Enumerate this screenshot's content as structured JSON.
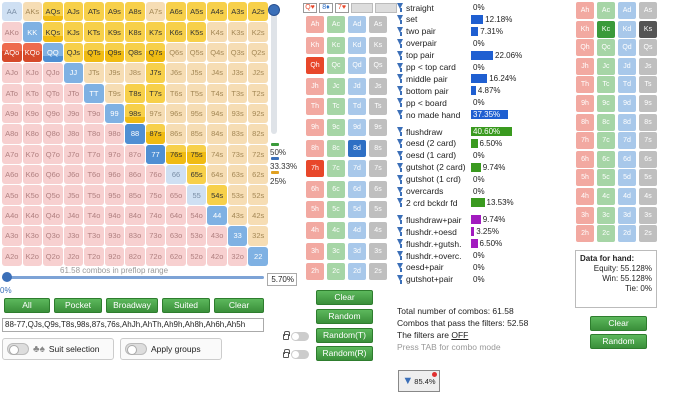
{
  "grid": {
    "ranks": [
      "A",
      "K",
      "Q",
      "J",
      "T",
      "9",
      "8",
      "7",
      "6",
      "5",
      "4",
      "3",
      "2"
    ],
    "cells": [
      [
        [
          "AA",
          "st"
        ],
        [
          "AKs",
          "st"
        ],
        [
          "AQs",
          "sel",
          0.3
        ],
        [
          "AJs",
          "sel"
        ],
        [
          "ATs",
          "sel"
        ],
        [
          "A9s",
          "sel"
        ],
        [
          "A8s",
          "sel"
        ],
        [
          "A7s",
          "st"
        ],
        [
          "A6s",
          "sel"
        ],
        [
          "A5s",
          "sel"
        ],
        [
          "A4s",
          "sel"
        ],
        [
          "A3s",
          "sel"
        ],
        [
          "A2s",
          "sel"
        ]
      ],
      [
        [
          "AKo",
          "st"
        ],
        [
          "KK",
          "sel"
        ],
        [
          "KQs",
          "sel",
          0.3
        ],
        [
          "KJs",
          "sel"
        ],
        [
          "KTs",
          "sel"
        ],
        [
          "K9s",
          "sel"
        ],
        [
          "K8s",
          "sel"
        ],
        [
          "K7s",
          "sel"
        ],
        [
          "K6s",
          "sel"
        ],
        [
          "K5s",
          "sel"
        ],
        [
          "K4s",
          "st"
        ],
        [
          "K3s",
          "st"
        ],
        [
          "K2s",
          "st"
        ]
      ],
      [
        [
          "AQo",
          "sel",
          0.6
        ],
        [
          "KQo",
          "sel",
          0.6
        ],
        [
          "QQ",
          "sel",
          0.3
        ],
        [
          "QJs",
          "sel"
        ],
        [
          "QTs",
          "sel",
          0.6
        ],
        [
          "Q9s",
          "sel",
          0.6
        ],
        [
          "Q8s",
          "sel"
        ],
        [
          "Q7s",
          "sel",
          0.6
        ],
        [
          "Q6s",
          "st"
        ],
        [
          "Q5s",
          "st"
        ],
        [
          "Q4s",
          "st"
        ],
        [
          "Q3s",
          "st"
        ],
        [
          "Q2s",
          "st"
        ]
      ],
      [
        [
          "AJo",
          "st"
        ],
        [
          "KJo",
          "st"
        ],
        [
          "QJo",
          "st"
        ],
        [
          "JJ",
          "sel"
        ],
        [
          "JTs",
          "st"
        ],
        [
          "J9s",
          "st"
        ],
        [
          "J8s",
          "st"
        ],
        [
          "J7s",
          "sel"
        ],
        [
          "J6s",
          "st"
        ],
        [
          "J5s",
          "st"
        ],
        [
          "J4s",
          "st"
        ],
        [
          "J3s",
          "st"
        ],
        [
          "J2s",
          "st"
        ]
      ],
      [
        [
          "ATo",
          "st"
        ],
        [
          "KTo",
          "st"
        ],
        [
          "QTo",
          "st"
        ],
        [
          "JTo",
          "st"
        ],
        [
          "TT",
          "sel"
        ],
        [
          "T9s",
          "st"
        ],
        [
          "T8s",
          "sel"
        ],
        [
          "T7s",
          "sel"
        ],
        [
          "T6s",
          "st"
        ],
        [
          "T5s",
          "st"
        ],
        [
          "T4s",
          "st"
        ],
        [
          "T3s",
          "st"
        ],
        [
          "T2s",
          "st"
        ]
      ],
      [
        [
          "A9o",
          "st"
        ],
        [
          "K9o",
          "st"
        ],
        [
          "Q9o",
          "st"
        ],
        [
          "J9o",
          "st"
        ],
        [
          "T9o",
          "st"
        ],
        [
          "99",
          "sel"
        ],
        [
          "98s",
          "sel",
          0.3
        ],
        [
          "97s",
          "st"
        ],
        [
          "96s",
          "st"
        ],
        [
          "95s",
          "st"
        ],
        [
          "94s",
          "st"
        ],
        [
          "93s",
          "st"
        ],
        [
          "92s",
          "st"
        ]
      ],
      [
        [
          "A8o",
          "st"
        ],
        [
          "K8o",
          "st"
        ],
        [
          "Q8o",
          "st"
        ],
        [
          "J8o",
          "st"
        ],
        [
          "T8o",
          "st"
        ],
        [
          "98o",
          "st"
        ],
        [
          "88",
          "sel",
          1
        ],
        [
          "87s",
          "sel",
          0.6
        ],
        [
          "86s",
          "st"
        ],
        [
          "85s",
          "st"
        ],
        [
          "84s",
          "st"
        ],
        [
          "83s",
          "st"
        ],
        [
          "82s",
          "st"
        ]
      ],
      [
        [
          "A7o",
          "st"
        ],
        [
          "K7o",
          "st"
        ],
        [
          "Q7o",
          "st"
        ],
        [
          "J7o",
          "st"
        ],
        [
          "T7o",
          "st"
        ],
        [
          "97o",
          "st"
        ],
        [
          "87o",
          "st"
        ],
        [
          "77",
          "sel",
          1
        ],
        [
          "76s",
          "sel",
          0.6
        ],
        [
          "75s",
          "sel",
          0.6
        ],
        [
          "74s",
          "st"
        ],
        [
          "73s",
          "st"
        ],
        [
          "72s",
          "st"
        ]
      ],
      [
        [
          "A6o",
          "st"
        ],
        [
          "K6o",
          "st"
        ],
        [
          "Q6o",
          "st"
        ],
        [
          "J6o",
          "st"
        ],
        [
          "T6o",
          "st"
        ],
        [
          "96o",
          "st"
        ],
        [
          "86o",
          "st"
        ],
        [
          "76o",
          "st"
        ],
        [
          "66",
          "st"
        ],
        [
          "65s",
          "sel"
        ],
        [
          "64s",
          "st"
        ],
        [
          "63s",
          "st"
        ],
        [
          "62s",
          "st"
        ]
      ],
      [
        [
          "A5o",
          "st"
        ],
        [
          "K5o",
          "st"
        ],
        [
          "Q5o",
          "st"
        ],
        [
          "J5o",
          "st"
        ],
        [
          "T5o",
          "st"
        ],
        [
          "95o",
          "st"
        ],
        [
          "85o",
          "st"
        ],
        [
          "75o",
          "st"
        ],
        [
          "65o",
          "st"
        ],
        [
          "55",
          "st"
        ],
        [
          "54s",
          "sel"
        ],
        [
          "53s",
          "st"
        ],
        [
          "52s",
          "st"
        ]
      ],
      [
        [
          "A4o",
          "st"
        ],
        [
          "K4o",
          "st"
        ],
        [
          "Q4o",
          "st"
        ],
        [
          "J4o",
          "st"
        ],
        [
          "T4o",
          "st"
        ],
        [
          "94o",
          "st"
        ],
        [
          "84o",
          "st"
        ],
        [
          "74o",
          "st"
        ],
        [
          "64o",
          "st"
        ],
        [
          "54o",
          "st"
        ],
        [
          "44",
          "sel"
        ],
        [
          "43s",
          "st"
        ],
        [
          "42s",
          "st"
        ]
      ],
      [
        [
          "A3o",
          "st"
        ],
        [
          "K3o",
          "st"
        ],
        [
          "Q3o",
          "st"
        ],
        [
          "J3o",
          "st"
        ],
        [
          "T3o",
          "st"
        ],
        [
          "93o",
          "st"
        ],
        [
          "83o",
          "st"
        ],
        [
          "73o",
          "st"
        ],
        [
          "63o",
          "st"
        ],
        [
          "53o",
          "st"
        ],
        [
          "43o",
          "st"
        ],
        [
          "33",
          "sel"
        ],
        [
          "32s",
          "st"
        ]
      ],
      [
        [
          "A2o",
          "st"
        ],
        [
          "K2o",
          "st"
        ],
        [
          "Q2o",
          "st"
        ],
        [
          "J2o",
          "st"
        ],
        [
          "T2o",
          "st"
        ],
        [
          "92o",
          "st"
        ],
        [
          "82o",
          "st"
        ],
        [
          "72o",
          "st"
        ],
        [
          "62o",
          "st"
        ],
        [
          "52o",
          "st"
        ],
        [
          "42o",
          "st"
        ],
        [
          "32o",
          "st"
        ],
        [
          "22",
          "sel"
        ]
      ]
    ]
  },
  "slider": {
    "vertical_labels": [
      "50%",
      "33.33%",
      "25%"
    ],
    "combos_caption": "61.58 combos in preflop range",
    "percent_value": "5.70%",
    "slider_pct": "0%"
  },
  "buttons": {
    "all": "All",
    "pocket": "Pocket",
    "broadway": "Broadway",
    "suited": "Suited",
    "clear": "Clear"
  },
  "range_text": "88-77,QJs,Q9s,T8s,98s,87s,76s,AhJh,AhTh,Ah9h,Ah8h,Ah6h,Ah5h",
  "toggles": {
    "suit_selection": "Suit selection",
    "apply_groups": "Apply groups"
  },
  "board": {
    "slots": [
      "Q♥",
      "8♦",
      "7♥"
    ],
    "ranks": [
      "A",
      "K",
      "Q",
      "J",
      "T",
      "9",
      "8",
      "7",
      "6",
      "5",
      "4",
      "3",
      "2"
    ],
    "suits": [
      "h",
      "c",
      "d",
      "s"
    ],
    "selected": [
      "Qh",
      "8d",
      "7h"
    ],
    "clear": "Clear",
    "random": "Random",
    "random_t": "Random(T)",
    "random_r": "Random(R)"
  },
  "stats": [
    {
      "label": "straight",
      "value": "0%",
      "pct": 0,
      "color": "#1f5fd1"
    },
    {
      "label": "set",
      "value": "12.18%",
      "pct": 12.18,
      "color": "#1f5fd1"
    },
    {
      "label": "two pair",
      "value": "7.31%",
      "pct": 7.31,
      "color": "#1f5fd1"
    },
    {
      "label": "overpair",
      "value": "0%",
      "pct": 0,
      "color": "#1f5fd1"
    },
    {
      "label": "top pair",
      "value": "22.06%",
      "pct": 22.06,
      "color": "#1f5fd1"
    },
    {
      "label": "pp < top card",
      "value": "0%",
      "pct": 0,
      "color": "#1f5fd1"
    },
    {
      "label": "middle pair",
      "value": "16.24%",
      "pct": 16.24,
      "color": "#1f5fd1"
    },
    {
      "label": "bottom pair",
      "value": "4.87%",
      "pct": 4.87,
      "color": "#1f5fd1"
    },
    {
      "label": "pp < board",
      "value": "0%",
      "pct": 0,
      "color": "#1f5fd1"
    },
    {
      "label": "no made hand",
      "value": "37.35%",
      "pct": 37.35,
      "color": "#1f5fd1"
    },
    {
      "label": "flushdraw",
      "value": "40.60%",
      "pct": 40.6,
      "color": "#3a9a1f"
    },
    {
      "label": "oesd (2 card)",
      "value": "6.50%",
      "pct": 6.5,
      "color": "#3a9a1f"
    },
    {
      "label": "oesd (1 card)",
      "value": "0%",
      "pct": 0,
      "color": "#3a9a1f"
    },
    {
      "label": "gutshot (2 card)",
      "value": "9.74%",
      "pct": 9.74,
      "color": "#3a9a1f"
    },
    {
      "label": "gutshot (1 crd)",
      "value": "0%",
      "pct": 0,
      "color": "#3a9a1f"
    },
    {
      "label": "overcards",
      "value": "0%",
      "pct": 0,
      "color": "#3a9a1f"
    },
    {
      "label": "2 crd bckdr fd",
      "value": "13.53%",
      "pct": 13.53,
      "color": "#3a9a1f"
    },
    {
      "label": "flushdraw+pair",
      "value": "9.74%",
      "pct": 9.74,
      "color": "#a21bbf"
    },
    {
      "label": "flushdr.+oesd",
      "value": "3.25%",
      "pct": 3.25,
      "color": "#a21bbf"
    },
    {
      "label": "flushdr.+gutsh.",
      "value": "6.50%",
      "pct": 6.5,
      "color": "#a21bbf"
    },
    {
      "label": "flushdr.+overc.",
      "value": "0%",
      "pct": 0,
      "color": "#a21bbf"
    },
    {
      "label": "oesd+pair",
      "value": "0%",
      "pct": 0,
      "color": "#a21bbf"
    },
    {
      "label": "gutshot+pair",
      "value": "0%",
      "pct": 0,
      "color": "#a21bbf"
    }
  ],
  "summary": {
    "total": "Total number of combos: 61.58",
    "pass": "Combos that pass the filters: 52.58",
    "filters_prefix": "The filters are ",
    "filters_state": "OFF",
    "hint": "Press TAB for combo mode"
  },
  "filter_icon": {
    "value": "85.4%"
  },
  "hand": {
    "cards": [
      [
        "Ah",
        "Ac",
        "Ad",
        "As"
      ],
      [
        "Kh",
        "Kc",
        "Kd",
        "Ks"
      ],
      [
        "Qh",
        "Qc",
        "Qd",
        "Qs"
      ],
      [
        "Jh",
        "Jc",
        "Jd",
        "Js"
      ],
      [
        "Th",
        "Tc",
        "Td",
        "Ts"
      ],
      [
        "9h",
        "9c",
        "9d",
        "9s"
      ],
      [
        "8h",
        "8c",
        "8d",
        "8s"
      ],
      [
        "7h",
        "7c",
        "7d",
        "7s"
      ],
      [
        "6h",
        "6c",
        "6d",
        "6s"
      ],
      [
        "5h",
        "5c",
        "5d",
        "5s"
      ],
      [
        "4h",
        "4c",
        "4d",
        "4s"
      ],
      [
        "3h",
        "3c",
        "3d",
        "3s"
      ],
      [
        "2h",
        "2c",
        "2d",
        "2s"
      ]
    ],
    "selected": [
      "Kc",
      "Ks"
    ],
    "title": "Data for hand:",
    "equity": "Equity: 55.128%",
    "win": "Win: 55.128%",
    "tie": "Tie: 0%",
    "clear": "Clear",
    "random": "Random"
  }
}
